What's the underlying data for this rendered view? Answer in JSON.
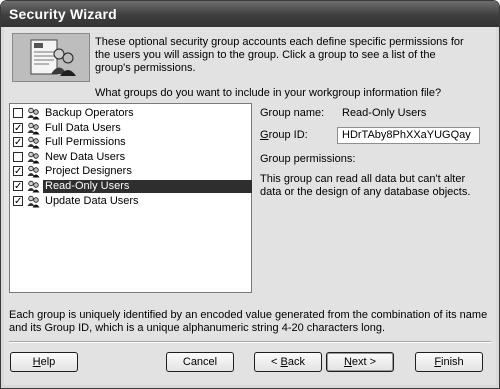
{
  "window": {
    "title": "Security Wizard"
  },
  "intro": {
    "text": "These optional security group accounts each define specific permissions for the users you will assign to the group. Click a group to see a list of the group's permissions."
  },
  "question": "What groups do you want to include in your workgroup information file?",
  "groups": [
    {
      "label": "Backup Operators",
      "checked": false,
      "selected": false
    },
    {
      "label": "Full Data Users",
      "checked": true,
      "selected": false
    },
    {
      "label": "Full Permissions",
      "checked": true,
      "selected": false
    },
    {
      "label": "New Data Users",
      "checked": false,
      "selected": false
    },
    {
      "label": "Project Designers",
      "checked": true,
      "selected": false
    },
    {
      "label": "Read-Only Users",
      "checked": true,
      "selected": true
    },
    {
      "label": "Update Data Users",
      "checked": true,
      "selected": false
    }
  ],
  "details": {
    "group_name_label": "Group name:",
    "group_name_value": "Read-Only Users",
    "group_id_label": "Group ID:",
    "group_id_value": "HDrTAby8PhXXaYUGQay",
    "permissions_label": "Group permissions:",
    "permissions_text": "This group can read all data but can't alter data or the design of any database objects."
  },
  "footer_text": "Each group is uniquely identified by an encoded value generated from the combination of its name and its Group ID, which is a unique alphanumeric string 4-20 characters long.",
  "buttons": {
    "help": "Help",
    "cancel": "Cancel",
    "back": "< Back",
    "next": "Next >",
    "finish": "Finish"
  },
  "icons": {
    "wizard": "security-wizard-icon",
    "group": "group-users-icon",
    "check": "checkmark-icon"
  }
}
